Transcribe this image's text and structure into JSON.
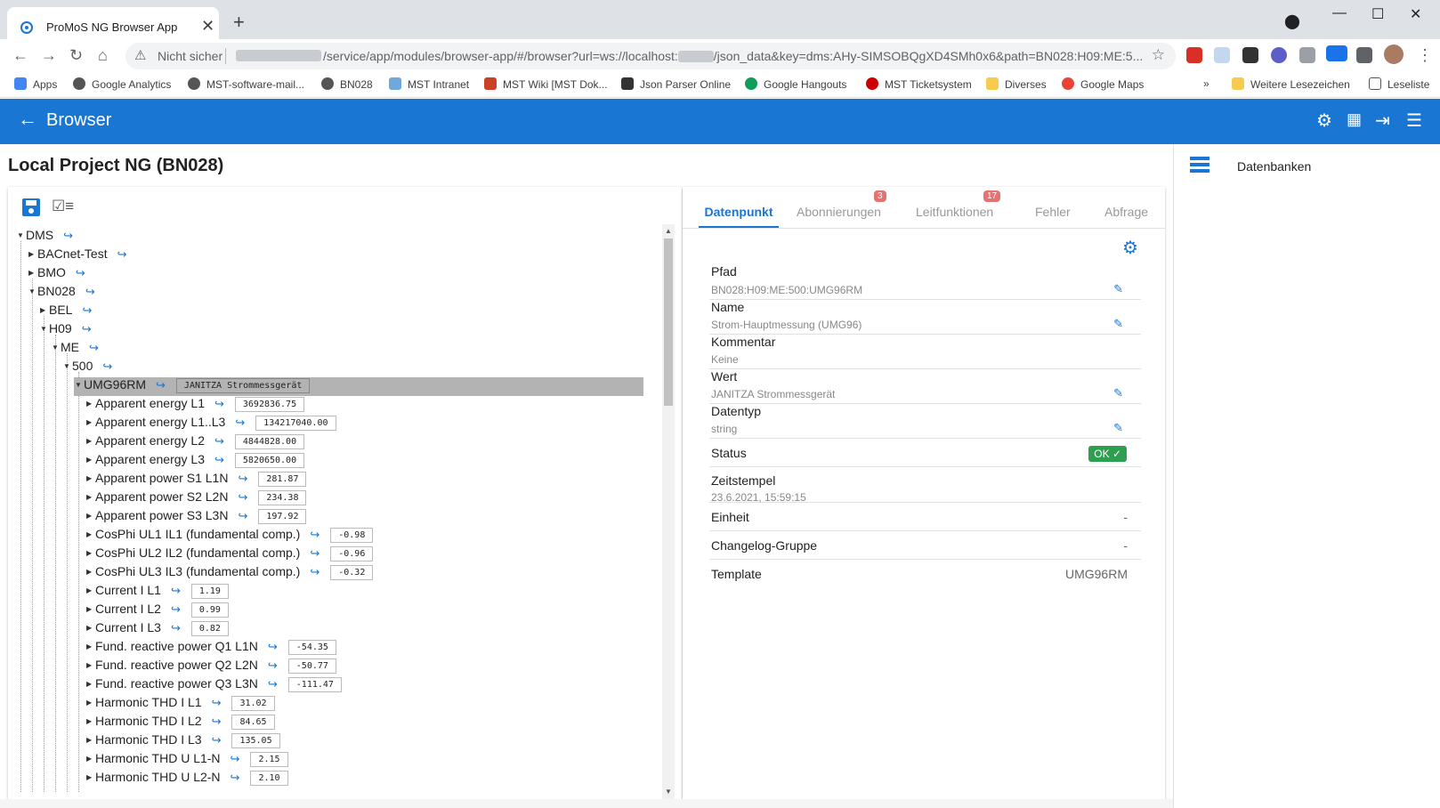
{
  "browser": {
    "tab_title": "ProMoS NG Browser App",
    "security_label": "Nicht sicher",
    "url": "/service/app/modules/browser-app/#/browser?url=ws://localhost:",
    "url_tail": "/json_data&key=dms:AHy-SIMSOBQgXD4SMh0x6&path=BN028:H09:ME:5...",
    "bookmarks": [
      "Apps",
      "Google Analytics",
      "MST-software-mail...",
      "BN028",
      "MST Intranet",
      "MST Wiki [MST Dok...",
      "Json Parser Online",
      "Google Hangouts",
      "MST Ticketsystem",
      "Diverses",
      "Google Maps"
    ],
    "bookmarks_more": "»",
    "bookmarks_other": "Weitere Lesezeichen",
    "reading_list": "Leseliste"
  },
  "appbar": {
    "title": "Browser"
  },
  "project_title": "Local Project NG (BN028)",
  "tree": [
    {
      "label": "DMS",
      "depth": 0,
      "open": true
    },
    {
      "label": "BACnet-Test",
      "depth": 1,
      "open": false
    },
    {
      "label": "BMO",
      "depth": 1,
      "open": false
    },
    {
      "label": "BN028",
      "depth": 1,
      "open": true
    },
    {
      "label": "BEL",
      "depth": 2,
      "open": false
    },
    {
      "label": "H09",
      "depth": 2,
      "open": true
    },
    {
      "label": "ME",
      "depth": 3,
      "open": true
    },
    {
      "label": "500",
      "depth": 4,
      "open": true
    },
    {
      "label": "UMG96RM",
      "depth": 5,
      "open": true,
      "value": "JANITZA Strommessgerät",
      "selected": true
    },
    {
      "label": "Apparent energy L1",
      "depth": 6,
      "value": "3692836.75"
    },
    {
      "label": "Apparent energy L1..L3",
      "depth": 6,
      "value": "134217040.00"
    },
    {
      "label": "Apparent energy L2",
      "depth": 6,
      "value": "4844828.00"
    },
    {
      "label": "Apparent energy L3",
      "depth": 6,
      "value": "5820650.00"
    },
    {
      "label": "Apparent power S1 L1N",
      "depth": 6,
      "value": "281.87"
    },
    {
      "label": "Apparent power S2 L2N",
      "depth": 6,
      "value": "234.38"
    },
    {
      "label": "Apparent power S3 L3N",
      "depth": 6,
      "value": "197.92"
    },
    {
      "label": "CosPhi UL1 IL1 (fundamental comp.)",
      "depth": 6,
      "value": "-0.98"
    },
    {
      "label": "CosPhi UL2 IL2 (fundamental comp.)",
      "depth": 6,
      "value": "-0.96"
    },
    {
      "label": "CosPhi UL3 IL3 (fundamental comp.)",
      "depth": 6,
      "value": "-0.32"
    },
    {
      "label": "Current I L1",
      "depth": 6,
      "value": "1.19"
    },
    {
      "label": "Current I L2",
      "depth": 6,
      "value": "0.99"
    },
    {
      "label": "Current I L3",
      "depth": 6,
      "value": "0.82"
    },
    {
      "label": "Fund. reactive power Q1 L1N",
      "depth": 6,
      "value": "-54.35"
    },
    {
      "label": "Fund. reactive power Q2 L2N",
      "depth": 6,
      "value": "-50.77"
    },
    {
      "label": "Fund. reactive power Q3 L3N",
      "depth": 6,
      "value": "-111.47"
    },
    {
      "label": "Harmonic THD I L1",
      "depth": 6,
      "value": "31.02"
    },
    {
      "label": "Harmonic THD I L2",
      "depth": 6,
      "value": "84.65"
    },
    {
      "label": "Harmonic THD I L3",
      "depth": 6,
      "value": "135.05"
    },
    {
      "label": "Harmonic THD U L1-N",
      "depth": 6,
      "value": "2.15"
    },
    {
      "label": "Harmonic THD U L2-N",
      "depth": 6,
      "value": "2.10"
    }
  ],
  "detail": {
    "tabs": [
      {
        "label": "Datenpunkt",
        "badge": ""
      },
      {
        "label": "Abonnierungen",
        "badge": "3"
      },
      {
        "label": "Leitfunktionen",
        "badge": "17"
      },
      {
        "label": "Fehler",
        "badge": ""
      },
      {
        "label": "Abfrage",
        "badge": ""
      }
    ],
    "props": [
      {
        "label": "Pfad",
        "value": "BN028:H09:ME:500:UMG96RM",
        "editable": true
      },
      {
        "label": "Name",
        "value": "Strom-Hauptmessung (UMG96)",
        "editable": true
      },
      {
        "label": "Kommentar",
        "value": "Keine",
        "editable": false
      },
      {
        "label": "Wert",
        "value": "JANITZA Strommessgerät",
        "editable": true
      },
      {
        "label": "Datentyp",
        "value": "string",
        "editable": true
      }
    ],
    "status_label": "Status",
    "status_value": "OK ✓",
    "timestamp_label": "Zeitstempel",
    "timestamp_value": "23.6.2021, 15:59:15",
    "inline_rows": [
      {
        "label": "Einheit",
        "value": "-"
      },
      {
        "label": "Changelog-Gruppe",
        "value": "-"
      },
      {
        "label": "Template",
        "value": "UMG96RM"
      }
    ]
  },
  "sidebar": {
    "item": "Datenbanken"
  },
  "colors": {
    "primary": "#1976d2",
    "ok": "#2e9e4f",
    "badge": "#e57373"
  }
}
